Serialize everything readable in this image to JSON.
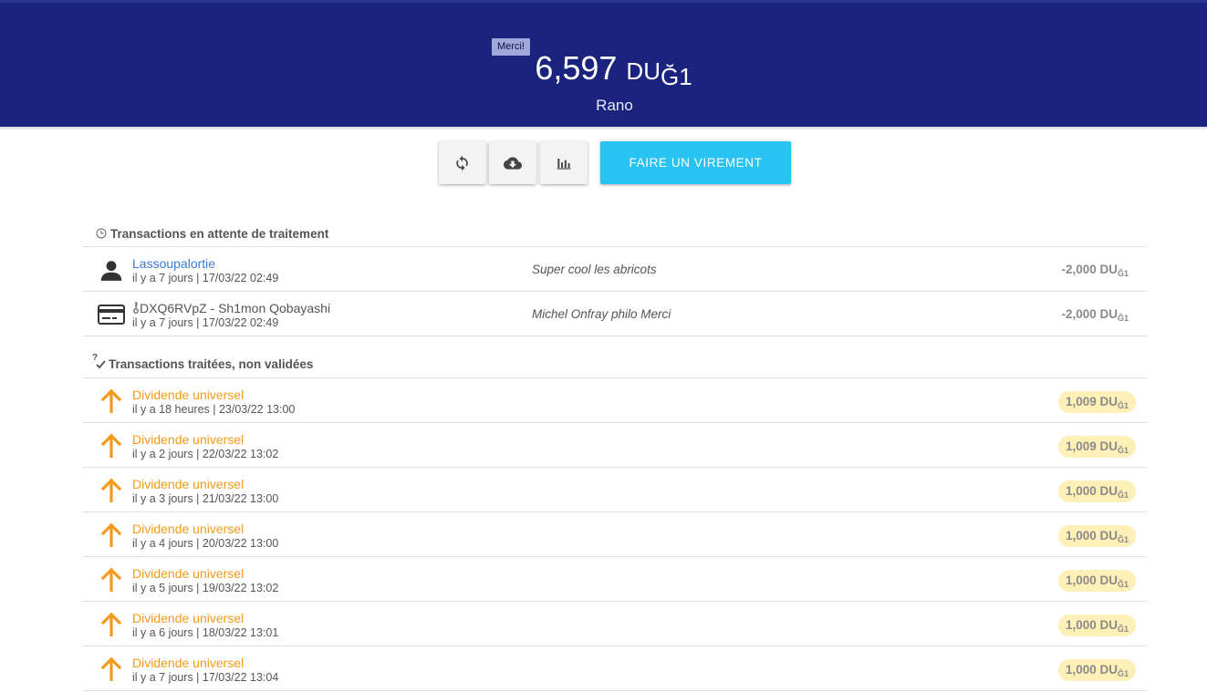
{
  "header": {
    "badge": "Merci!",
    "balance_value": "6,597",
    "balance_unit": "DU",
    "balance_currency": "Ğ1",
    "wallet_name": "Rano",
    "background_color": "#1a237e"
  },
  "toolbar": {
    "refresh_icon": "refresh-icon",
    "download_icon": "cloud-download-icon",
    "stats_icon": "bar-chart-icon",
    "transfer_label": "FAIRE UN VIREMENT",
    "transfer_color": "#29c3f3"
  },
  "pending": {
    "title": "Transactions en attente de traitement",
    "icon": "clock-icon",
    "rows": [
      {
        "icon": "person-icon",
        "title": "Lassoupalortie",
        "time": "il y a 7 jours | 17/03/22 02:49",
        "comment": "Super cool les abricots",
        "amount": "-2,000 DU",
        "currency": "Ğ1"
      },
      {
        "icon": "credit-card-icon",
        "key_icon": "key-icon",
        "title": "DXQ6RVpZ - Sh1mon Qobayashi",
        "time": "il y a 7 jours | 17/03/22 02:49",
        "comment": "Michel Onfray philo Merci",
        "amount": "-2,000 DU",
        "currency": "Ğ1"
      }
    ]
  },
  "processed": {
    "title": "Transactions traitées, non validées",
    "icon": "unconfirmed-check-icon",
    "rows": [
      {
        "title": "Dividende universel",
        "time": "il y a 18 heures | 23/03/22 13:00",
        "amount": "1,009 DU",
        "currency": "Ğ1"
      },
      {
        "title": "Dividende universel",
        "time": "il y a 2 jours | 22/03/22 13:02",
        "amount": "1,009 DU",
        "currency": "Ğ1"
      },
      {
        "title": "Dividende universel",
        "time": "il y a 3 jours | 21/03/22 13:00",
        "amount": "1,000 DU",
        "currency": "Ğ1"
      },
      {
        "title": "Dividende universel",
        "time": "il y a 4 jours | 20/03/22 13:00",
        "amount": "1,000 DU",
        "currency": "Ğ1"
      },
      {
        "title": "Dividende universel",
        "time": "il y a 5 jours | 19/03/22 13:02",
        "amount": "1,000 DU",
        "currency": "Ğ1"
      },
      {
        "title": "Dividende universel",
        "time": "il y a 6 jours | 18/03/22 13:01",
        "amount": "1,000 DU",
        "currency": "Ğ1"
      },
      {
        "title": "Dividende universel",
        "time": "il y a 7 jours | 17/03/22 13:04",
        "amount": "1,000 DU",
        "currency": "Ğ1"
      }
    ],
    "row_icon": "arrow-up-icon",
    "accent_color": "#f39a1c",
    "pill_color": "#fff0b8"
  }
}
